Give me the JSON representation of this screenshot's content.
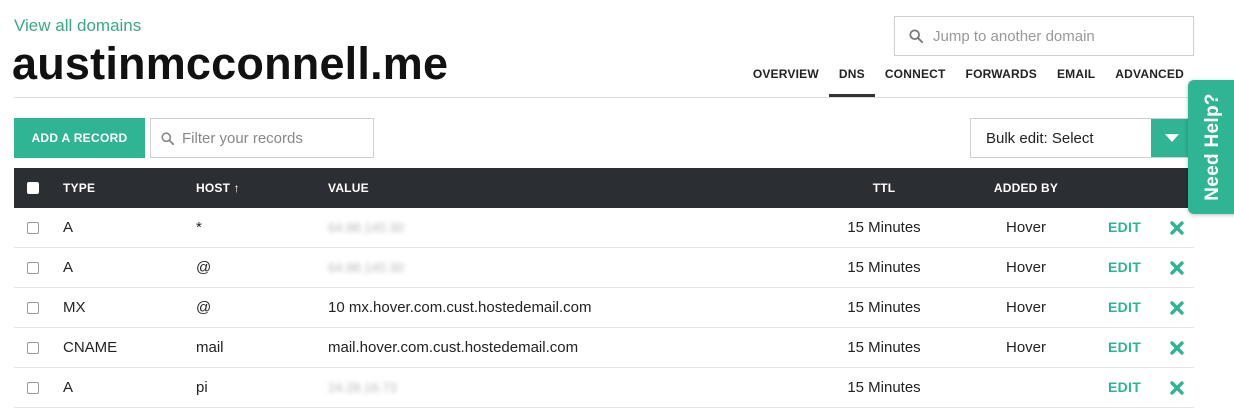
{
  "header": {
    "view_all_label": "View all domains",
    "domain_name": "austinmcconnell.me",
    "jump_placeholder": "Jump to another domain"
  },
  "tabs": [
    {
      "label": "OVERVIEW",
      "active": false
    },
    {
      "label": "DNS",
      "active": true
    },
    {
      "label": "CONNECT",
      "active": false
    },
    {
      "label": "FORWARDS",
      "active": false
    },
    {
      "label": "EMAIL",
      "active": false
    },
    {
      "label": "ADVANCED",
      "active": false
    }
  ],
  "toolbar": {
    "add_record_label": "ADD A RECORD",
    "filter_placeholder": "Filter your records",
    "bulk_edit_label": "Bulk edit: Select"
  },
  "table": {
    "columns": {
      "type": "TYPE",
      "host": "HOST ↑",
      "value": "VALUE",
      "ttl": "TTL",
      "added_by": "ADDED BY"
    },
    "edit_label": "EDIT",
    "rows": [
      {
        "type": "A",
        "host": "*",
        "value": "64.98.145.30",
        "value_blurred": true,
        "ttl": "15 Minutes",
        "added_by": "Hover"
      },
      {
        "type": "A",
        "host": "@",
        "value": "64.98.145.30",
        "value_blurred": true,
        "ttl": "15 Minutes",
        "added_by": "Hover"
      },
      {
        "type": "MX",
        "host": "@",
        "value": "10 mx.hover.com.cust.hostedemail.com",
        "value_blurred": false,
        "ttl": "15 Minutes",
        "added_by": "Hover"
      },
      {
        "type": "CNAME",
        "host": "mail",
        "value": "mail.hover.com.cust.hostedemail.com",
        "value_blurred": false,
        "ttl": "15 Minutes",
        "added_by": "Hover"
      },
      {
        "type": "A",
        "host": "pi",
        "value": "24.28.16.73",
        "value_blurred": true,
        "ttl": "15 Minutes",
        "added_by": ""
      }
    ]
  },
  "help_tab_label": "Need Help?",
  "colors": {
    "accent": "#2fb594",
    "link": "#3aa886",
    "table_header_bg": "#2b2e33",
    "delete_icon": "#2fb594"
  },
  "icons": {
    "search": "search-icon",
    "caret": "caret-down-icon",
    "delete": "delete-x-icon"
  }
}
